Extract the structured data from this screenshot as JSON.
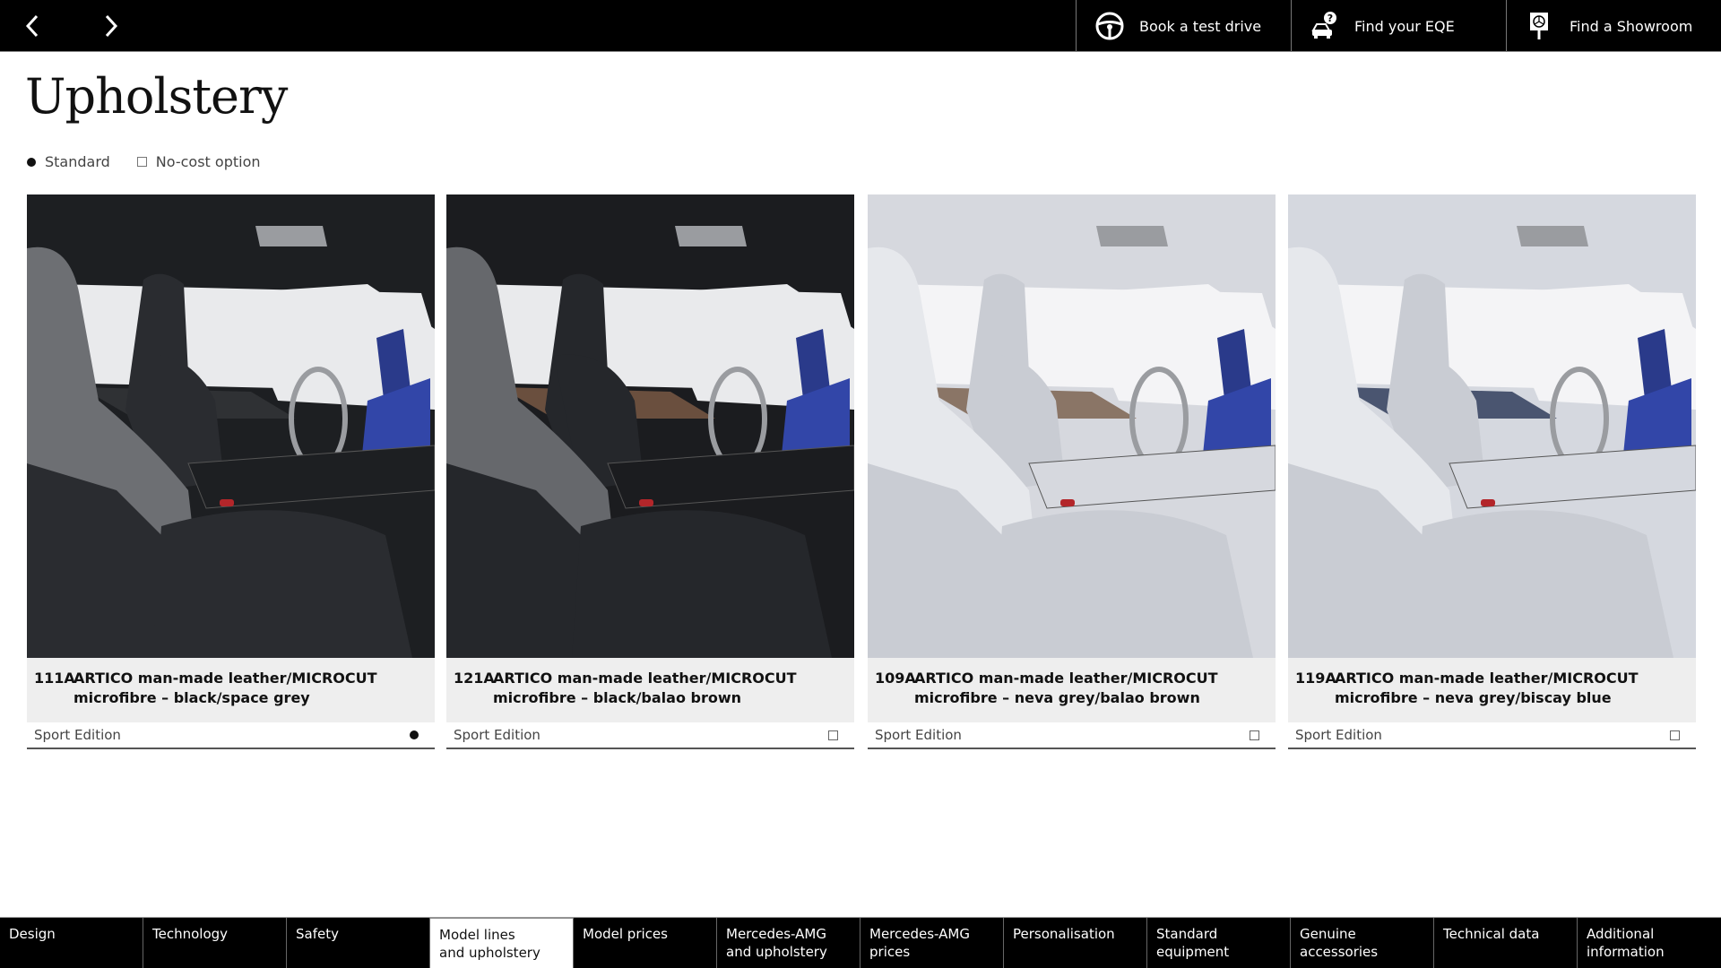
{
  "topbar": {
    "prev_icon": "chevron-left-icon",
    "next_icon": "chevron-right-icon",
    "actions": [
      {
        "label": "Book a test drive",
        "icon": "steering-wheel-icon"
      },
      {
        "label": "Find your EQE",
        "icon": "car-question-icon"
      },
      {
        "label": "Find a Showroom",
        "icon": "showroom-pin-icon"
      }
    ]
  },
  "page": {
    "title": "Upholstery",
    "legend": {
      "standard": "Standard",
      "no_cost": "No-cost option"
    }
  },
  "cards": [
    {
      "code": "111A",
      "description": "ARTICO man-made leather/MICROCUT microfibre – black/space grey",
      "line": "Sport Edition",
      "status": "standard",
      "palette": {
        "seat": "#2a2c30",
        "seat_light": "#6d6f73",
        "cabin": "#1d1f22",
        "window": "#e9eaec",
        "accent": "#2f3134"
      }
    },
    {
      "code": "121A",
      "description": "ARTICO man-made leather/MICROCUT microfibre – black/balao brown",
      "line": "Sport Edition",
      "status": "no-cost",
      "palette": {
        "seat": "#25272b",
        "seat_light": "#66686c",
        "cabin": "#1b1c1f",
        "window": "#e9eaec",
        "accent": "#6a4f3e"
      }
    },
    {
      "code": "109A",
      "description": "ARTICO man-made leather/MICROCUT microfibre – neva grey/balao brown",
      "line": "Sport Edition",
      "status": "no-cost",
      "palette": {
        "seat": "#c9ccd3",
        "seat_light": "#e6e8ec",
        "cabin": "#d6d8de",
        "window": "#f4f4f6",
        "accent": "#8a7566"
      }
    },
    {
      "code": "119A",
      "description": "ARTICO man-made leather/MICROCUT microfibre – neva grey/biscay blue",
      "line": "Sport Edition",
      "status": "no-cost",
      "palette": {
        "seat": "#c9ccd3",
        "seat_light": "#e6e8ec",
        "cabin": "#d5d8df",
        "window": "#f4f4f6",
        "accent": "#4a5570"
      }
    }
  ],
  "bottom_nav": {
    "active_index": 3,
    "tabs": [
      {
        "line1": "Design",
        "line2": ""
      },
      {
        "line1": "Technology",
        "line2": ""
      },
      {
        "line1": "Safety",
        "line2": ""
      },
      {
        "line1": "Model lines",
        "line2": "and upholstery"
      },
      {
        "line1": "Model prices",
        "line2": ""
      },
      {
        "line1": "Mercedes-AMG",
        "line2": "and upholstery"
      },
      {
        "line1": "Mercedes-AMG",
        "line2": "prices"
      },
      {
        "line1": "Personalisation",
        "line2": ""
      },
      {
        "line1": "Standard",
        "line2": "equipment"
      },
      {
        "line1": "Genuine",
        "line2": "accessories"
      },
      {
        "line1": "Technical data",
        "line2": ""
      },
      {
        "line1": "Additional",
        "line2": "information"
      }
    ]
  }
}
